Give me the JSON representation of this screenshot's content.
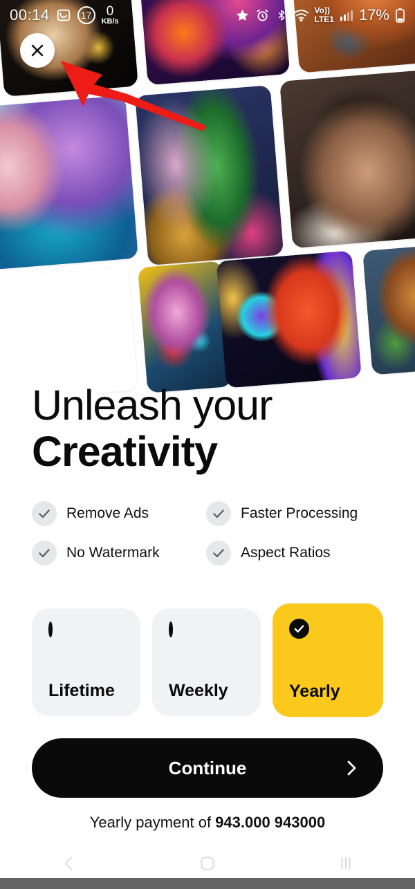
{
  "status_bar": {
    "clock": "00:14",
    "screenshot_icon": "screenshot-icon",
    "notification_count": "17",
    "net_speed_value": "0",
    "net_speed_unit": "KB/s",
    "star_icon": "star-icon",
    "alarm_icon": "alarm-clock-icon",
    "bluetooth_icon": "bluetooth-icon",
    "wifi_icon": "wifi-icon",
    "volte_line1": "Vo))",
    "volte_line2": "LTE1",
    "signal_icon": "signal-bars-icon",
    "battery_percent": "17%",
    "battery_icon": "battery-icon"
  },
  "close_button": {
    "name": "close-icon",
    "glyph": "✕"
  },
  "annotation": {
    "type": "red-arrow",
    "points_to": "close-button"
  },
  "collage": {
    "tiles": [
      {
        "name": "tile-makeup-portrait",
        "art": "art-makeup"
      },
      {
        "name": "tile-psychedelic-face",
        "art": "art-psych"
      },
      {
        "name": "tile-fox-sculpture",
        "art": "art-fox"
      },
      {
        "name": "tile-blue-hair-woman",
        "art": "art-blueface"
      },
      {
        "name": "tile-pink-room-plant",
        "art": "art-room"
      },
      {
        "name": "tile-snow-man-face",
        "art": "art-man"
      },
      {
        "name": "tile-general-cat",
        "art": "art-cat"
      },
      {
        "name": "tile-arcade-machine",
        "art": "art-arcade"
      },
      {
        "name": "tile-anime-goggles",
        "art": "art-anime"
      },
      {
        "name": "tile-pagoda-house",
        "art": "art-pagoda"
      },
      {
        "name": "tile-teal-abstract",
        "art": "art-teal"
      },
      {
        "name": "tile-warm-abstract",
        "art": "art-warm"
      }
    ]
  },
  "headline": {
    "line1": "Unleash your",
    "line2": "Creativity"
  },
  "features": [
    {
      "label": "Remove Ads",
      "icon": "check-icon"
    },
    {
      "label": "Faster Processing",
      "icon": "check-icon"
    },
    {
      "label": "No Watermark",
      "icon": "check-icon"
    },
    {
      "label": "Aspect Ratios",
      "icon": "check-icon"
    }
  ],
  "plans": [
    {
      "label": "Lifetime",
      "selected": false,
      "icon": "radio-empty-icon"
    },
    {
      "label": "Weekly",
      "selected": false,
      "icon": "radio-empty-icon"
    },
    {
      "label": "Yearly",
      "selected": true,
      "icon": "radio-checked-icon"
    }
  ],
  "cta": {
    "label": "Continue",
    "chevron": "chevron-right-icon"
  },
  "payment_note": {
    "prefix": "Yearly payment of ",
    "amount": "943.000 943000"
  },
  "nav_bar": {
    "back": "back-icon",
    "home": "home-icon",
    "recents": "recents-icon"
  },
  "colors": {
    "accent_yellow": "#FBC91B",
    "cta_black": "#0A0A0A",
    "card_gray": "#F1F2F4",
    "check_circle_gray": "#E6E7E9",
    "check_mark_gray": "#5A5A5A",
    "nav_strip_gray": "#646464"
  }
}
